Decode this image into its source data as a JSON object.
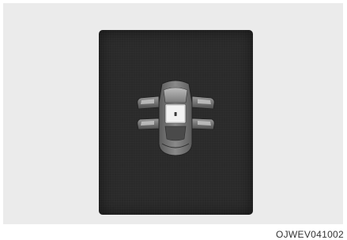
{
  "figure": {
    "code": "OJWEV041002",
    "icon": "door-open-warning-icon"
  }
}
